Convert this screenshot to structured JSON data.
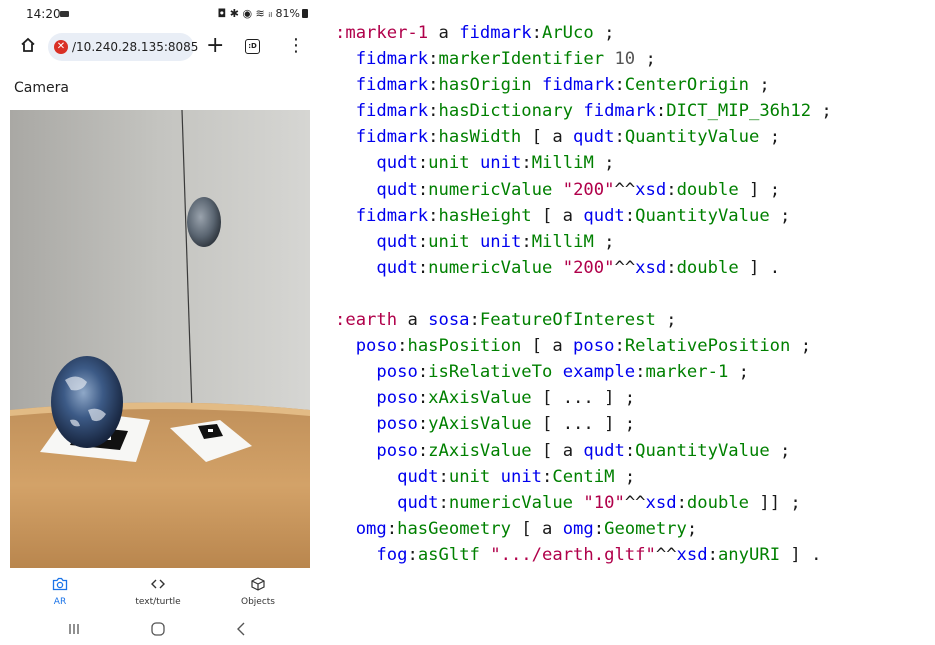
{
  "phone": {
    "status_bar": {
      "time": "14:20",
      "right": "◘ ✱ ◉ ≋ ᵢₗ 81%"
    },
    "browser": {
      "url": "/10.240.28.135:8085",
      "tab_count": ":D"
    },
    "page_title": "Camera",
    "bottom_nav": [
      {
        "label": "AR",
        "icon": "camera-icon",
        "active": true
      },
      {
        "label": "text/turtle",
        "icon": "code-icon",
        "active": false
      },
      {
        "label": "Objects",
        "icon": "cube-icon",
        "active": false
      }
    ],
    "system_nav": [
      "recents-icon",
      "home-icon",
      "back-icon"
    ]
  },
  "code": {
    "lines": [
      [
        {
          "t": ":marker-1 ",
          "c": "prefix2"
        },
        {
          "t": "a ",
          "c": "plain"
        },
        {
          "t": "fidmark",
          "c": "prefix"
        },
        {
          "t": ":",
          "c": "plain"
        },
        {
          "t": "ArUco",
          "c": "local"
        },
        {
          "t": " ;",
          "c": "plain"
        }
      ],
      [
        {
          "t": "  ",
          "c": "plain"
        },
        {
          "t": "fidmark",
          "c": "prefix"
        },
        {
          "t": ":",
          "c": "plain"
        },
        {
          "t": "markerIdentifier",
          "c": "local"
        },
        {
          "t": " ",
          "c": "plain"
        },
        {
          "t": "10",
          "c": "num"
        },
        {
          "t": " ;",
          "c": "plain"
        }
      ],
      [
        {
          "t": "  ",
          "c": "plain"
        },
        {
          "t": "fidmark",
          "c": "prefix"
        },
        {
          "t": ":",
          "c": "plain"
        },
        {
          "t": "hasOrigin",
          "c": "local"
        },
        {
          "t": " ",
          "c": "plain"
        },
        {
          "t": "fidmark",
          "c": "prefix"
        },
        {
          "t": ":",
          "c": "plain"
        },
        {
          "t": "CenterOrigin",
          "c": "local"
        },
        {
          "t": " ;",
          "c": "plain"
        }
      ],
      [
        {
          "t": "  ",
          "c": "plain"
        },
        {
          "t": "fidmark",
          "c": "prefix"
        },
        {
          "t": ":",
          "c": "plain"
        },
        {
          "t": "hasDictionary",
          "c": "local"
        },
        {
          "t": " ",
          "c": "plain"
        },
        {
          "t": "fidmark",
          "c": "prefix"
        },
        {
          "t": ":",
          "c": "plain"
        },
        {
          "t": "DICT_MIP_36h12",
          "c": "local"
        },
        {
          "t": " ;",
          "c": "plain"
        }
      ],
      [
        {
          "t": "  ",
          "c": "plain"
        },
        {
          "t": "fidmark",
          "c": "prefix"
        },
        {
          "t": ":",
          "c": "plain"
        },
        {
          "t": "hasWidth",
          "c": "local"
        },
        {
          "t": " [ a ",
          "c": "plain"
        },
        {
          "t": "qudt",
          "c": "prefix"
        },
        {
          "t": ":",
          "c": "plain"
        },
        {
          "t": "QuantityValue",
          "c": "local"
        },
        {
          "t": " ;",
          "c": "plain"
        }
      ],
      [
        {
          "t": "    ",
          "c": "plain"
        },
        {
          "t": "qudt",
          "c": "prefix"
        },
        {
          "t": ":",
          "c": "plain"
        },
        {
          "t": "unit",
          "c": "local"
        },
        {
          "t": " ",
          "c": "plain"
        },
        {
          "t": "unit",
          "c": "prefix"
        },
        {
          "t": ":",
          "c": "plain"
        },
        {
          "t": "MilliM",
          "c": "local"
        },
        {
          "t": " ;",
          "c": "plain"
        }
      ],
      [
        {
          "t": "    ",
          "c": "plain"
        },
        {
          "t": "qudt",
          "c": "prefix"
        },
        {
          "t": ":",
          "c": "plain"
        },
        {
          "t": "numericValue",
          "c": "local"
        },
        {
          "t": " ",
          "c": "plain"
        },
        {
          "t": "\"200\"",
          "c": "str"
        },
        {
          "t": "^^",
          "c": "plain"
        },
        {
          "t": "xsd",
          "c": "prefix"
        },
        {
          "t": ":",
          "c": "plain"
        },
        {
          "t": "double",
          "c": "local"
        },
        {
          "t": " ] ;",
          "c": "plain"
        }
      ],
      [
        {
          "t": "  ",
          "c": "plain"
        },
        {
          "t": "fidmark",
          "c": "prefix"
        },
        {
          "t": ":",
          "c": "plain"
        },
        {
          "t": "hasHeight",
          "c": "local"
        },
        {
          "t": " [ a ",
          "c": "plain"
        },
        {
          "t": "qudt",
          "c": "prefix"
        },
        {
          "t": ":",
          "c": "plain"
        },
        {
          "t": "QuantityValue",
          "c": "local"
        },
        {
          "t": " ;",
          "c": "plain"
        }
      ],
      [
        {
          "t": "    ",
          "c": "plain"
        },
        {
          "t": "qudt",
          "c": "prefix"
        },
        {
          "t": ":",
          "c": "plain"
        },
        {
          "t": "unit",
          "c": "local"
        },
        {
          "t": " ",
          "c": "plain"
        },
        {
          "t": "unit",
          "c": "prefix"
        },
        {
          "t": ":",
          "c": "plain"
        },
        {
          "t": "MilliM",
          "c": "local"
        },
        {
          "t": " ;",
          "c": "plain"
        }
      ],
      [
        {
          "t": "    ",
          "c": "plain"
        },
        {
          "t": "qudt",
          "c": "prefix"
        },
        {
          "t": ":",
          "c": "plain"
        },
        {
          "t": "numericValue",
          "c": "local"
        },
        {
          "t": " ",
          "c": "plain"
        },
        {
          "t": "\"200\"",
          "c": "str"
        },
        {
          "t": "^^",
          "c": "plain"
        },
        {
          "t": "xsd",
          "c": "prefix"
        },
        {
          "t": ":",
          "c": "plain"
        },
        {
          "t": "double",
          "c": "local"
        },
        {
          "t": " ] .",
          "c": "plain"
        }
      ],
      [],
      [
        {
          "t": ":earth ",
          "c": "prefix2"
        },
        {
          "t": "a ",
          "c": "plain"
        },
        {
          "t": "sosa",
          "c": "prefix"
        },
        {
          "t": ":",
          "c": "plain"
        },
        {
          "t": "FeatureOfInterest",
          "c": "local"
        },
        {
          "t": " ;",
          "c": "plain"
        }
      ],
      [
        {
          "t": "  ",
          "c": "plain"
        },
        {
          "t": "poso",
          "c": "prefix"
        },
        {
          "t": ":",
          "c": "plain"
        },
        {
          "t": "hasPosition",
          "c": "local"
        },
        {
          "t": " [ a ",
          "c": "plain"
        },
        {
          "t": "poso",
          "c": "prefix"
        },
        {
          "t": ":",
          "c": "plain"
        },
        {
          "t": "RelativePosition",
          "c": "local"
        },
        {
          "t": " ;",
          "c": "plain"
        }
      ],
      [
        {
          "t": "    ",
          "c": "plain"
        },
        {
          "t": "poso",
          "c": "prefix"
        },
        {
          "t": ":",
          "c": "plain"
        },
        {
          "t": "isRelativeTo",
          "c": "local"
        },
        {
          "t": " ",
          "c": "plain"
        },
        {
          "t": "example",
          "c": "prefix"
        },
        {
          "t": ":",
          "c": "plain"
        },
        {
          "t": "marker-1",
          "c": "local"
        },
        {
          "t": " ;",
          "c": "plain"
        }
      ],
      [
        {
          "t": "    ",
          "c": "plain"
        },
        {
          "t": "poso",
          "c": "prefix"
        },
        {
          "t": ":",
          "c": "plain"
        },
        {
          "t": "xAxisValue",
          "c": "local"
        },
        {
          "t": " [ ... ] ;",
          "c": "plain"
        }
      ],
      [
        {
          "t": "    ",
          "c": "plain"
        },
        {
          "t": "poso",
          "c": "prefix"
        },
        {
          "t": ":",
          "c": "plain"
        },
        {
          "t": "yAxisValue",
          "c": "local"
        },
        {
          "t": " [ ... ] ;",
          "c": "plain"
        }
      ],
      [
        {
          "t": "    ",
          "c": "plain"
        },
        {
          "t": "poso",
          "c": "prefix"
        },
        {
          "t": ":",
          "c": "plain"
        },
        {
          "t": "zAxisValue",
          "c": "local"
        },
        {
          "t": " [ a ",
          "c": "plain"
        },
        {
          "t": "qudt",
          "c": "prefix"
        },
        {
          "t": ":",
          "c": "plain"
        },
        {
          "t": "QuantityValue",
          "c": "local"
        },
        {
          "t": " ;",
          "c": "plain"
        }
      ],
      [
        {
          "t": "      ",
          "c": "plain"
        },
        {
          "t": "qudt",
          "c": "prefix"
        },
        {
          "t": ":",
          "c": "plain"
        },
        {
          "t": "unit",
          "c": "local"
        },
        {
          "t": " ",
          "c": "plain"
        },
        {
          "t": "unit",
          "c": "prefix"
        },
        {
          "t": ":",
          "c": "plain"
        },
        {
          "t": "CentiM",
          "c": "local"
        },
        {
          "t": " ;",
          "c": "plain"
        }
      ],
      [
        {
          "t": "      ",
          "c": "plain"
        },
        {
          "t": "qudt",
          "c": "prefix"
        },
        {
          "t": ":",
          "c": "plain"
        },
        {
          "t": "numericValue",
          "c": "local"
        },
        {
          "t": " ",
          "c": "plain"
        },
        {
          "t": "\"10\"",
          "c": "str"
        },
        {
          "t": "^^",
          "c": "plain"
        },
        {
          "t": "xsd",
          "c": "prefix"
        },
        {
          "t": ":",
          "c": "plain"
        },
        {
          "t": "double",
          "c": "local"
        },
        {
          "t": " ]] ;",
          "c": "plain"
        }
      ],
      [
        {
          "t": "  ",
          "c": "plain"
        },
        {
          "t": "omg",
          "c": "prefix"
        },
        {
          "t": ":",
          "c": "plain"
        },
        {
          "t": "hasGeometry",
          "c": "local"
        },
        {
          "t": " [ a ",
          "c": "plain"
        },
        {
          "t": "omg",
          "c": "prefix"
        },
        {
          "t": ":",
          "c": "plain"
        },
        {
          "t": "Geometry",
          "c": "local"
        },
        {
          "t": ";",
          "c": "plain"
        }
      ],
      [
        {
          "t": "    ",
          "c": "plain"
        },
        {
          "t": "fog",
          "c": "prefix"
        },
        {
          "t": ":",
          "c": "plain"
        },
        {
          "t": "asGltf",
          "c": "local"
        },
        {
          "t": " ",
          "c": "plain"
        },
        {
          "t": "\".../earth.gltf\"",
          "c": "str"
        },
        {
          "t": "^^",
          "c": "plain"
        },
        {
          "t": "xsd",
          "c": "prefix"
        },
        {
          "t": ":",
          "c": "plain"
        },
        {
          "t": "anyURI",
          "c": "local"
        },
        {
          "t": " ] .",
          "c": "plain"
        }
      ]
    ]
  },
  "colors": {
    "prefix": "#0000ee",
    "subject": "#b0004a",
    "local": "#008000",
    "string": "#b0004a",
    "active_tab": "#1a73e8"
  }
}
